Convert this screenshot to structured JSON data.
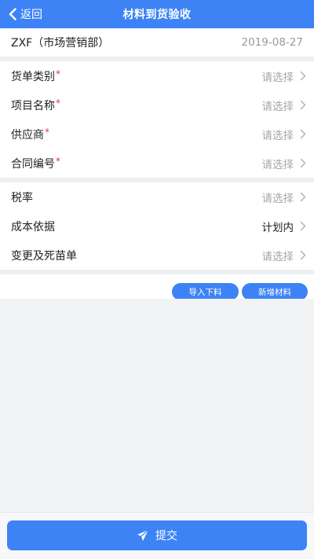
{
  "colors": {
    "accent": "#3d83f5",
    "required": "#e53935",
    "placeholder": "#a6a6a6"
  },
  "nav": {
    "back_label": "返回",
    "title": "材料到货验收",
    "back_icon": "chevron-left-icon"
  },
  "header": {
    "dept": "ZXF（市场营销部）",
    "date": "2019-08-27"
  },
  "group1": {
    "rows": [
      {
        "label": "货单类别",
        "required": "*",
        "value": "请选择"
      },
      {
        "label": "项目名称",
        "required": "*",
        "value": "请选择"
      },
      {
        "label": "供应商",
        "required": "*",
        "value": "请选择"
      },
      {
        "label": "合同编号",
        "required": "*",
        "value": "请选择"
      }
    ]
  },
  "group2": {
    "rows": [
      {
        "label": "税率",
        "value": "请选择"
      },
      {
        "label": "成本依据",
        "value": "计划内"
      },
      {
        "label": "变更及死苗单",
        "value": "请选择"
      }
    ]
  },
  "actions": {
    "import_label": "导入下料",
    "add_label": "新增材料"
  },
  "footer": {
    "submit_label": "提交",
    "submit_icon": "paper-plane-icon"
  }
}
